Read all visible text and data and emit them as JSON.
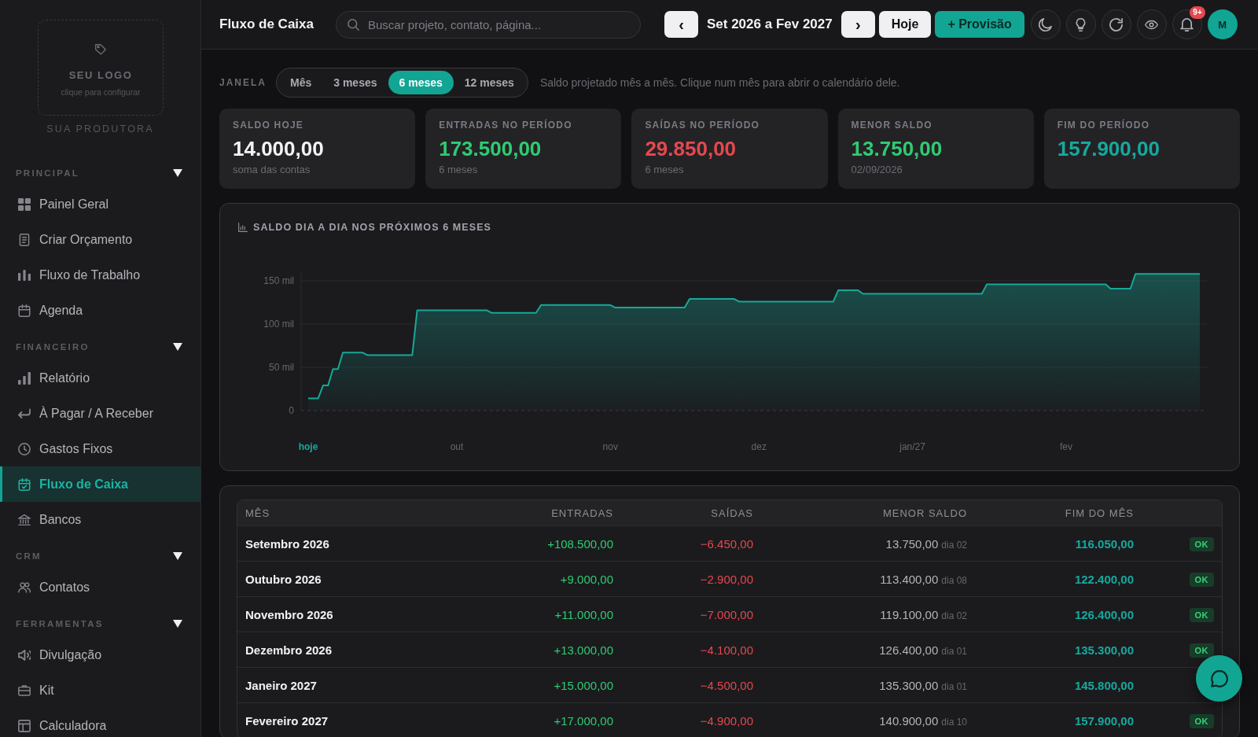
{
  "sidebar": {
    "logo": {
      "title": "SEU LOGO",
      "hint": "clique para configurar"
    },
    "company": "SUA PRODUTORA",
    "sections": [
      {
        "title": "PRINCIPAL",
        "expanded": true,
        "items": [
          {
            "label": "Painel Geral",
            "selected": false
          },
          {
            "label": "Criar Orçamento",
            "selected": false
          },
          {
            "label": "Fluxo de Trabalho",
            "selected": false
          },
          {
            "label": "Agenda",
            "selected": false
          }
        ]
      },
      {
        "title": "FINANCEIRO",
        "expanded": true,
        "items": [
          {
            "label": "Relatório",
            "selected": false
          },
          {
            "label": "À Pagar / A Receber",
            "selected": false
          },
          {
            "label": "Gastos Fixos",
            "selected": false
          },
          {
            "label": "Fluxo de Caixa",
            "selected": true
          },
          {
            "label": "Bancos",
            "selected": false
          }
        ]
      },
      {
        "title": "CRM",
        "expanded": true,
        "items": [
          {
            "label": "Contatos",
            "selected": false
          }
        ]
      },
      {
        "title": "FERRAMENTAS",
        "expanded": true,
        "items": [
          {
            "label": "Divulgação",
            "selected": false
          },
          {
            "label": "Kit",
            "selected": false
          },
          {
            "label": "Calculadora",
            "selected": false
          }
        ]
      }
    ]
  },
  "header": {
    "title": "Fluxo de Caixa",
    "search": {
      "placeholder": "Buscar projeto, contato, página..."
    },
    "period": {
      "previous": "‹",
      "label": "Set 2026 a Fev 2027",
      "next": "›"
    },
    "buttons": [
      {
        "label": "Hoje",
        "kind": "secondary"
      },
      {
        "label": "+ Provisão",
        "kind": "primary"
      }
    ],
    "notifications": "9+",
    "avatar": "M"
  },
  "window_selector": {
    "label": "JANELA",
    "options": [
      {
        "label": "Mês",
        "selected": false
      },
      {
        "label": "3 meses",
        "selected": false
      },
      {
        "label": "6 meses",
        "selected": true
      },
      {
        "label": "12 meses",
        "selected": false
      }
    ],
    "hint": "Saldo projetado mês a mês. Clique num mês para abrir o calendário dele."
  },
  "summary_cards": [
    {
      "label": "SALDO HOJE",
      "value": "14.000,00",
      "note": "soma das contas",
      "color": "#f3f3f5"
    },
    {
      "label": "ENTRADAS NO PERÍODO",
      "value": "173.500,00",
      "note": "6 meses",
      "color": "#2ecc71"
    },
    {
      "label": "SAÍDAS NO PERÍODO",
      "value": "29.850,00",
      "note": "6 meses",
      "color": "#e5484d"
    },
    {
      "label": "MENOR SALDO",
      "value": "13.750,00",
      "note": "02/09/2026",
      "color": "#2ecc71"
    },
    {
      "label": "FIM DO PERÍODO",
      "value": "157.900,00",
      "color": "#17a99d"
    }
  ],
  "chart": {
    "chart_data": {
      "type": "area",
      "title": "SALDO DIA A DIA NOS PRÓXIMOS 6 MESES",
      "categories": [
        "hoje",
        null,
        null,
        null,
        null,
        null,
        null,
        null,
        null,
        null,
        null,
        null,
        null,
        null,
        null,
        null,
        null,
        null,
        null,
        null,
        null,
        null,
        null,
        null,
        null,
        null,
        null,
        null,
        null,
        null,
        "out",
        null,
        null,
        null,
        null,
        null,
        null,
        null,
        null,
        null,
        null,
        null,
        null,
        null,
        null,
        null,
        null,
        null,
        null,
        null,
        null,
        null,
        null,
        null,
        null,
        null,
        null,
        null,
        null,
        null,
        null,
        "nov",
        null,
        null,
        null,
        null,
        null,
        null,
        null,
        null,
        null,
        null,
        null,
        null,
        null,
        null,
        null,
        null,
        null,
        null,
        null,
        null,
        null,
        null,
        null,
        null,
        null,
        null,
        null,
        null,
        null,
        "dez",
        null,
        null,
        null,
        null,
        null,
        null,
        null,
        null,
        null,
        null,
        null,
        null,
        null,
        null,
        null,
        null,
        null,
        null,
        null,
        null,
        null,
        null,
        null,
        null,
        null,
        null,
        null,
        null,
        null,
        null,
        "jan/27",
        null,
        null,
        null,
        null,
        null,
        null,
        null,
        null,
        null,
        null,
        null,
        null,
        null,
        null,
        null,
        null,
        null,
        null,
        null,
        null,
        null,
        null,
        null,
        null,
        null,
        null,
        null,
        null,
        null,
        null,
        "fev",
        null,
        null,
        null,
        null,
        null,
        null,
        null,
        null,
        null,
        null,
        null,
        null,
        null,
        null,
        null,
        null,
        null,
        null,
        null,
        null,
        null,
        null,
        null,
        null,
        null,
        null,
        null
      ],
      "series": [
        {
          "color": "#17a898",
          "values": [
            14,
            14,
            14,
            29,
            29,
            48,
            48,
            67,
            67,
            67,
            67,
            67,
            64,
            64,
            64,
            64,
            64,
            64,
            64,
            64,
            64,
            64,
            116,
            116,
            116,
            116,
            116,
            116,
            116,
            116,
            116,
            116,
            116,
            116,
            116,
            116,
            116,
            113,
            113,
            113,
            113,
            113,
            113,
            113,
            113,
            113,
            113,
            122,
            122,
            122,
            122,
            122,
            122,
            122,
            122,
            122,
            122,
            122,
            122,
            122,
            122,
            122,
            119,
            119,
            119,
            119,
            119,
            119,
            119,
            119,
            119,
            119,
            119,
            119,
            119,
            119,
            119,
            129,
            129,
            129,
            129,
            129,
            129,
            129,
            129,
            129,
            129,
            126,
            126,
            126,
            126,
            126,
            126,
            126,
            126,
            126,
            126,
            126,
            126,
            126,
            126,
            126,
            126,
            126,
            126,
            126,
            126,
            139,
            139,
            139,
            139,
            139,
            135,
            135,
            135,
            135,
            135,
            135,
            135,
            135,
            135,
            135,
            135,
            135,
            135,
            135,
            135,
            135,
            135,
            135,
            135,
            135,
            135,
            135,
            135,
            135,
            135,
            146,
            146,
            146,
            146,
            146,
            146,
            146,
            146,
            146,
            146,
            146,
            146,
            146,
            146,
            146,
            146,
            146,
            146,
            146,
            146,
            146,
            146,
            146,
            146,
            146,
            141,
            141,
            141,
            141,
            141,
            158,
            158,
            158,
            158,
            158,
            158,
            158,
            158,
            158,
            158,
            158,
            158,
            158,
            158
          ]
        }
      ],
      "ylim": [
        0,
        160
      ],
      "yticks": [
        0,
        {
          "value": 50,
          "label": "50 mil"
        },
        {
          "value": 100,
          "label": "100 mil"
        },
        {
          "value": 150,
          "label": "150 mil"
        }
      ],
      "grid": true
    }
  },
  "table": {
    "columns": [
      "MÊS",
      "ENTRADAS",
      "SAÍDAS",
      "MENOR SALDO",
      "FIM DO MÊS"
    ],
    "rows": [
      {
        "month": "Setembro 2026",
        "income": "+108.500,00",
        "expense": "−6.450,00",
        "min_balance": "13.750,00",
        "min_day": "dia 02",
        "end_balance": "116.050,00",
        "status": "OK"
      },
      {
        "month": "Outubro 2026",
        "income": "+9.000,00",
        "expense": "−2.900,00",
        "min_balance": "113.400,00",
        "min_day": "dia 08",
        "end_balance": "122.400,00",
        "status": "OK"
      },
      {
        "month": "Novembro 2026",
        "income": "+11.000,00",
        "expense": "−7.000,00",
        "min_balance": "119.100,00",
        "min_day": "dia 02",
        "end_balance": "126.400,00",
        "status": "OK"
      },
      {
        "month": "Dezembro 2026",
        "income": "+13.000,00",
        "expense": "−4.100,00",
        "min_balance": "126.400,00",
        "min_day": "dia 01",
        "end_balance": "135.300,00",
        "status": "OK"
      },
      {
        "month": "Janeiro 2027",
        "income": "+15.000,00",
        "expense": "−4.500,00",
        "min_balance": "135.300,00",
        "min_day": "dia 01",
        "end_balance": "145.800,00"
      },
      {
        "month": "Fevereiro 2027",
        "income": "+17.000,00",
        "expense": "−4.900,00",
        "min_balance": "140.900,00",
        "min_day": "dia 10",
        "end_balance": "157.900,00",
        "status": "OK"
      }
    ]
  }
}
